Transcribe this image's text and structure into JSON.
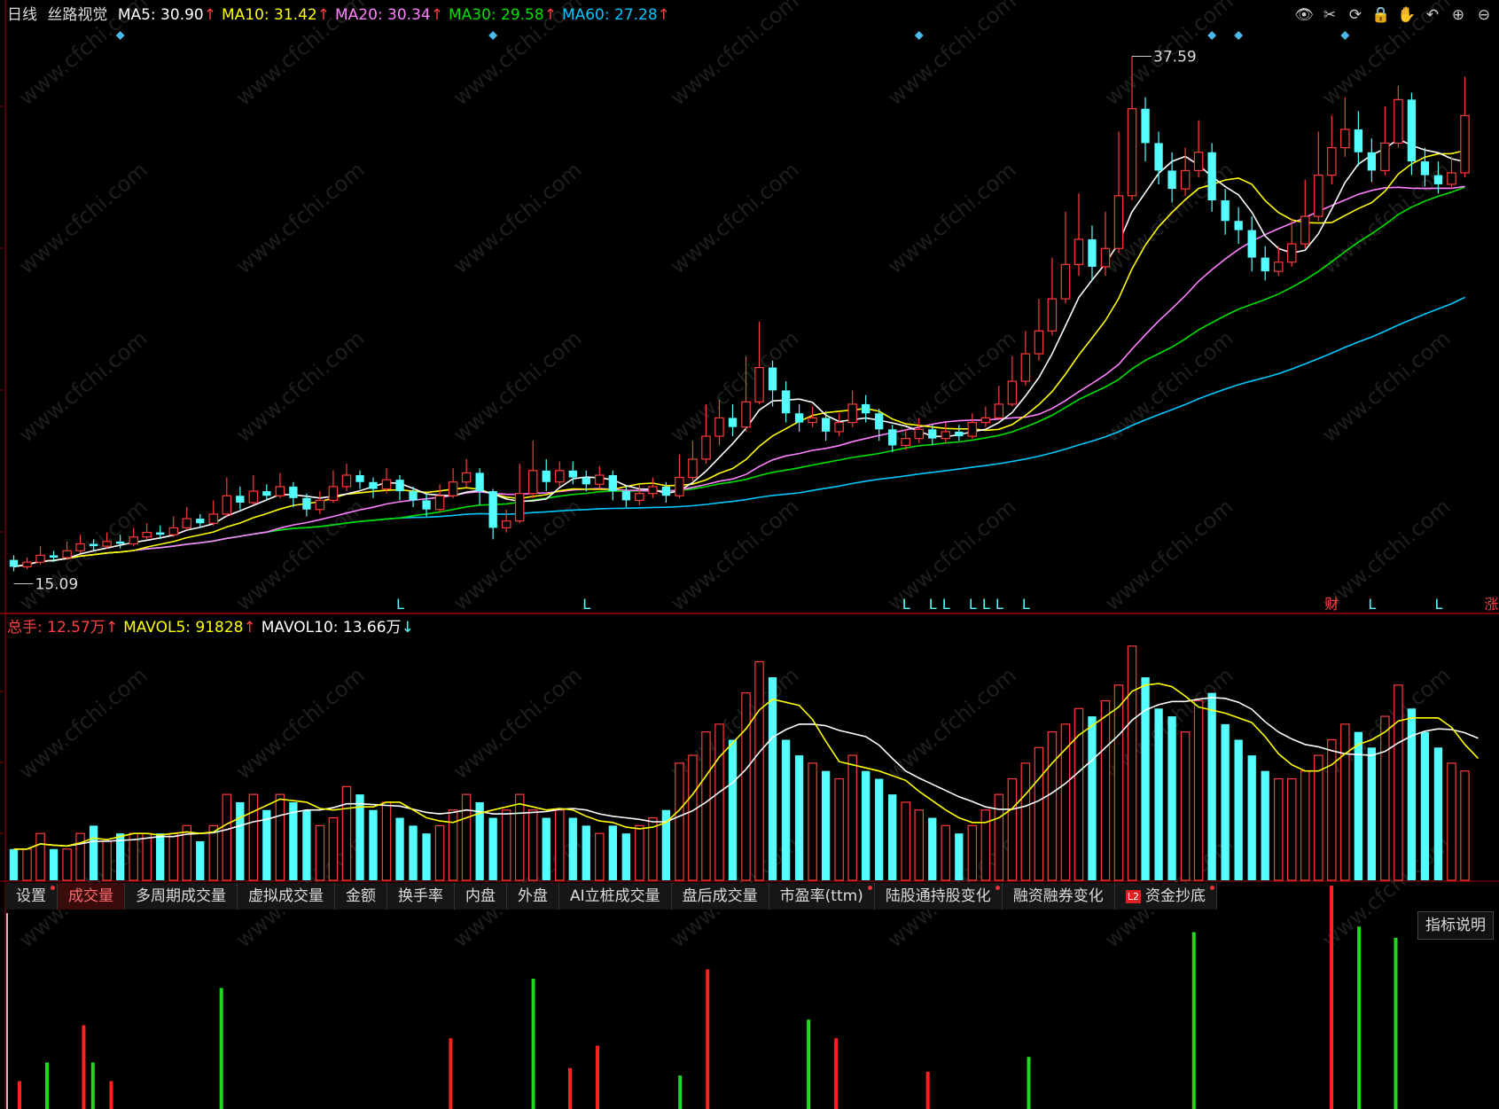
{
  "header": {
    "period": "日线",
    "stock_name": "丝路视觉",
    "ma_items": [
      {
        "label": "MA5: 30.90",
        "arrow": "↑",
        "color": "#ffffff"
      },
      {
        "label": "MA10: 31.42",
        "arrow": "↑",
        "color": "#ffff00"
      },
      {
        "label": "MA20: 30.34",
        "arrow": "↑",
        "color": "#ff80ff"
      },
      {
        "label": "MA30: 29.58",
        "arrow": "↑",
        "color": "#00e000"
      },
      {
        "label": "MA60: 27.28",
        "arrow": "↑",
        "color": "#00c8ff"
      }
    ]
  },
  "toolbar_icons": [
    "eye-icon",
    "scissors-icon",
    "refresh-icon",
    "lock-icon",
    "hand-icon",
    "undo-icon",
    "zoom-in-icon",
    "zoom-out-icon"
  ],
  "annotations": {
    "high_label": "37.59",
    "low_label": "15.09"
  },
  "markers": {
    "L": "L",
    "cai": "财",
    "zhang": "涨"
  },
  "volume_header": {
    "items": [
      {
        "label": "总手: 12.57万",
        "arrow": "↑",
        "color": "#ff4040"
      },
      {
        "label": "MAVOL5: 91828",
        "arrow": "↑",
        "color": "#ffff00"
      },
      {
        "label": "MAVOL10: 13.66万",
        "arrow": "↓",
        "color": "#ffffff"
      }
    ]
  },
  "tabs": [
    {
      "label": "设置",
      "active": false,
      "dot": true
    },
    {
      "label": "成交量",
      "active": true,
      "dot": false
    },
    {
      "label": "多周期成交量",
      "active": false,
      "dot": false
    },
    {
      "label": "虚拟成交量",
      "active": false,
      "dot": false
    },
    {
      "label": "金额",
      "active": false,
      "dot": false
    },
    {
      "label": "换手率",
      "active": false,
      "dot": false
    },
    {
      "label": "内盘",
      "active": false,
      "dot": false
    },
    {
      "label": "外盘",
      "active": false,
      "dot": false
    },
    {
      "label": "AI立桩成交量",
      "active": false,
      "dot": false
    },
    {
      "label": "盘后成交量",
      "active": false,
      "dot": false
    },
    {
      "label": "市盈率(ttm)",
      "active": false,
      "dot": true
    },
    {
      "label": "陆股通持股变化",
      "active": false,
      "dot": true
    },
    {
      "label": "融资融券变化",
      "active": false,
      "dot": false
    },
    {
      "label": "资金抄底",
      "active": false,
      "dot": true,
      "badge": "L2"
    }
  ],
  "explain_button": "指标说明",
  "watermark": "www.cfchi.com",
  "colors": {
    "up": "#ff3b3b",
    "down": "#54ffff",
    "bg": "#000000",
    "grid": "#7a0000"
  },
  "chart_data": {
    "type": "candlestick",
    "price_range": [
      15.09,
      37.59
    ],
    "high_label": 37.59,
    "low_label": 15.09,
    "candles": [
      [
        15.6,
        15.3,
        15.8,
        15.1
      ],
      [
        15.3,
        15.5,
        15.7,
        15.2
      ],
      [
        15.5,
        15.8,
        16.2,
        15.4
      ],
      [
        15.8,
        15.7,
        16.0,
        15.5
      ],
      [
        15.7,
        16.0,
        16.4,
        15.6
      ],
      [
        16.0,
        16.3,
        16.7,
        15.9
      ],
      [
        16.3,
        16.2,
        16.5,
        16.0
      ],
      [
        16.2,
        16.4,
        16.8,
        16.1
      ],
      [
        16.4,
        16.3,
        16.7,
        16.1
      ],
      [
        16.3,
        16.6,
        17.0,
        16.2
      ],
      [
        16.6,
        16.8,
        17.2,
        16.5
      ],
      [
        16.8,
        16.7,
        17.1,
        16.5
      ],
      [
        16.7,
        17.0,
        17.5,
        16.6
      ],
      [
        17.0,
        17.4,
        17.9,
        16.9
      ],
      [
        17.4,
        17.2,
        17.6,
        17.0
      ],
      [
        17.2,
        17.6,
        18.2,
        17.1
      ],
      [
        17.6,
        18.4,
        19.2,
        17.5
      ],
      [
        18.4,
        18.1,
        18.8,
        17.8
      ],
      [
        18.1,
        18.6,
        19.3,
        18.0
      ],
      [
        18.6,
        18.4,
        18.9,
        18.2
      ],
      [
        18.4,
        18.8,
        19.4,
        18.3
      ],
      [
        18.8,
        18.3,
        19.0,
        17.9
      ],
      [
        18.3,
        17.8,
        18.5,
        17.5
      ],
      [
        17.8,
        18.2,
        18.6,
        17.6
      ],
      [
        18.2,
        18.8,
        19.5,
        18.1
      ],
      [
        18.8,
        19.3,
        19.8,
        18.6
      ],
      [
        19.3,
        19.0,
        19.5,
        18.7
      ],
      [
        19.0,
        18.7,
        19.2,
        18.3
      ],
      [
        18.7,
        19.1,
        19.6,
        18.5
      ],
      [
        19.1,
        18.6,
        19.3,
        18.2
      ],
      [
        18.6,
        18.2,
        18.8,
        17.9
      ],
      [
        18.2,
        17.8,
        18.5,
        17.5
      ],
      [
        17.8,
        18.4,
        18.9,
        17.7
      ],
      [
        18.4,
        19.0,
        19.6,
        18.3
      ],
      [
        19.0,
        19.4,
        20.0,
        18.8
      ],
      [
        19.4,
        18.6,
        19.6,
        18.0
      ],
      [
        18.6,
        17.0,
        18.7,
        16.5
      ],
      [
        17.0,
        17.3,
        17.8,
        16.8
      ],
      [
        17.3,
        18.5,
        19.8,
        17.2
      ],
      [
        18.5,
        19.5,
        20.8,
        18.3
      ],
      [
        19.5,
        19.0,
        20.0,
        18.6
      ],
      [
        19.0,
        19.5,
        19.9,
        18.8
      ],
      [
        19.5,
        19.2,
        19.9,
        18.9
      ],
      [
        19.2,
        18.9,
        19.5,
        18.6
      ],
      [
        18.9,
        19.3,
        19.7,
        18.7
      ],
      [
        19.3,
        18.6,
        19.5,
        18.2
      ],
      [
        18.6,
        18.2,
        18.8,
        17.9
      ],
      [
        18.2,
        18.5,
        18.9,
        18.0
      ],
      [
        18.5,
        18.8,
        19.2,
        18.3
      ],
      [
        18.8,
        18.4,
        19.0,
        18.1
      ],
      [
        18.4,
        19.2,
        20.2,
        18.3
      ],
      [
        19.2,
        20.0,
        20.8,
        19.0
      ],
      [
        20.0,
        21.0,
        22.4,
        19.8
      ],
      [
        21.0,
        21.8,
        22.6,
        20.6
      ],
      [
        21.8,
        21.4,
        22.4,
        21.0
      ],
      [
        21.4,
        22.5,
        24.5,
        21.2
      ],
      [
        22.5,
        24.0,
        26.0,
        22.4
      ],
      [
        24.0,
        23.0,
        24.3,
        22.3
      ],
      [
        23.0,
        22.0,
        23.4,
        21.6
      ],
      [
        22.0,
        21.6,
        22.4,
        21.2
      ],
      [
        21.6,
        21.8,
        22.3,
        21.4
      ],
      [
        21.8,
        21.2,
        22.1,
        20.8
      ],
      [
        21.2,
        21.6,
        22.0,
        21.0
      ],
      [
        21.6,
        22.4,
        23.0,
        21.4
      ],
      [
        22.4,
        22.0,
        22.8,
        21.6
      ],
      [
        22.0,
        21.3,
        22.2,
        20.8
      ],
      [
        21.3,
        20.6,
        21.5,
        20.3
      ],
      [
        20.6,
        20.9,
        21.3,
        20.4
      ],
      [
        20.9,
        21.3,
        21.8,
        20.7
      ],
      [
        21.3,
        20.9,
        21.5,
        20.6
      ],
      [
        20.9,
        21.2,
        21.6,
        20.7
      ],
      [
        21.2,
        21.0,
        21.5,
        20.8
      ],
      [
        21.0,
        21.6,
        22.0,
        20.9
      ],
      [
        21.6,
        21.8,
        22.3,
        21.4
      ],
      [
        21.8,
        22.4,
        23.2,
        21.7
      ],
      [
        22.4,
        23.4,
        24.5,
        22.3
      ],
      [
        23.4,
        24.6,
        25.6,
        23.2
      ],
      [
        24.6,
        25.6,
        27.0,
        24.3
      ],
      [
        25.6,
        27.0,
        28.8,
        25.4
      ],
      [
        27.0,
        28.5,
        30.8,
        26.8
      ],
      [
        28.5,
        29.6,
        31.6,
        28.0
      ],
      [
        29.6,
        28.4,
        30.2,
        27.8
      ],
      [
        28.4,
        29.2,
        30.8,
        28.0
      ],
      [
        29.2,
        31.5,
        34.3,
        29.0
      ],
      [
        31.5,
        35.3,
        37.59,
        31.3
      ],
      [
        35.3,
        33.8,
        35.8,
        33.0
      ],
      [
        33.8,
        32.6,
        34.3,
        32.0
      ],
      [
        32.6,
        31.8,
        33.4,
        31.2
      ],
      [
        31.8,
        32.6,
        33.6,
        31.5
      ],
      [
        32.6,
        33.4,
        34.8,
        32.3
      ],
      [
        33.4,
        31.3,
        33.8,
        30.8
      ],
      [
        31.3,
        30.4,
        31.8,
        29.8
      ],
      [
        30.4,
        30.0,
        31.0,
        29.4
      ],
      [
        30.0,
        28.8,
        30.6,
        28.2
      ],
      [
        28.8,
        28.2,
        29.3,
        27.8
      ],
      [
        28.2,
        28.6,
        29.3,
        28.0
      ],
      [
        28.6,
        29.4,
        30.5,
        28.4
      ],
      [
        29.4,
        30.6,
        32.2,
        29.2
      ],
      [
        30.6,
        32.4,
        34.3,
        30.4
      ],
      [
        32.4,
        33.6,
        35.0,
        32.0
      ],
      [
        33.6,
        34.4,
        35.8,
        33.2
      ],
      [
        34.4,
        33.4,
        35.2,
        32.8
      ],
      [
        33.4,
        32.6,
        34.0,
        32.1
      ],
      [
        32.6,
        33.8,
        35.4,
        32.4
      ],
      [
        33.8,
        35.7,
        36.3,
        33.6
      ],
      [
        35.7,
        33.0,
        36.0,
        32.4
      ],
      [
        33.0,
        32.4,
        33.6,
        31.9
      ],
      [
        32.4,
        32.0,
        33.0,
        31.6
      ],
      [
        32.0,
        32.5,
        33.2,
        31.8
      ],
      [
        32.5,
        35.0,
        36.7,
        32.3
      ]
    ],
    "moving_averages": {
      "MA5": {
        "current": 30.9,
        "color": "#ffffff"
      },
      "MA10": {
        "current": 31.42,
        "color": "#ffff00"
      },
      "MA20": {
        "current": 30.34,
        "color": "#ff80ff"
      },
      "MA30": {
        "current": 29.58,
        "color": "#00e000"
      },
      "MA60": {
        "current": 27.28,
        "color": "#00c8ff"
      }
    },
    "l_markers": [
      29,
      43,
      67,
      69,
      70,
      72,
      73,
      74,
      76,
      102,
      107
    ],
    "cai_marker": 99,
    "zhang_marker": 111,
    "volume": {
      "total": "12.57万",
      "mavol5": 91828,
      "mavol10": "13.66万",
      "values": [
        2.0,
        2.0,
        3.0,
        2.0,
        2.0,
        3.0,
        3.5,
        2.5,
        3.0,
        3.0,
        3.0,
        3.0,
        3.0,
        3.5,
        2.5,
        3.5,
        5.5,
        5.0,
        5.5,
        4.5,
        5.5,
        5.0,
        4.5,
        3.5,
        4.0,
        6.0,
        5.5,
        4.5,
        5.0,
        4.0,
        3.5,
        3.0,
        3.5,
        4.5,
        5.5,
        5.0,
        4.0,
        4.5,
        5.5,
        4.5,
        4.0,
        4.5,
        4.0,
        3.5,
        3.0,
        3.5,
        3.0,
        3.5,
        4.0,
        4.5,
        7.5,
        8.0,
        9.5,
        10.0,
        9.0,
        12.0,
        14.0,
        13.0,
        9.0,
        8.0,
        7.5,
        7.0,
        6.5,
        8.0,
        7.0,
        6.5,
        5.5,
        5.0,
        4.5,
        4.0,
        3.5,
        3.0,
        3.5,
        4.5,
        5.5,
        6.5,
        7.5,
        8.5,
        9.5,
        10.0,
        11.0,
        10.5,
        11.5,
        12.5,
        15.0,
        13.0,
        11.0,
        10.5,
        9.5,
        11.5,
        12.0,
        10.0,
        9.0,
        8.0,
        7.0,
        6.5,
        6.5,
        7.0,
        8.0,
        9.0,
        10.0,
        9.5,
        8.5,
        10.5,
        12.5,
        11.0,
        9.5,
        8.5,
        7.5,
        7.0,
        6.5
      ],
      "unit": "万"
    },
    "capital_bottom": {
      "bars": [
        {
          "i": 0,
          "v": 0.15,
          "c": "red"
        },
        {
          "i": 3,
          "v": 0.25,
          "c": "green"
        },
        {
          "i": 7,
          "v": 0.45,
          "c": "red"
        },
        {
          "i": 8,
          "v": 0.25,
          "c": "green"
        },
        {
          "i": 10,
          "v": 0.15,
          "c": "red"
        },
        {
          "i": 22,
          "v": 0.65,
          "c": "green"
        },
        {
          "i": 47,
          "v": 0.38,
          "c": "red"
        },
        {
          "i": 56,
          "v": 0.7,
          "c": "green"
        },
        {
          "i": 60,
          "v": 0.22,
          "c": "red"
        },
        {
          "i": 63,
          "v": 0.34,
          "c": "red"
        },
        {
          "i": 72,
          "v": 0.18,
          "c": "green"
        },
        {
          "i": 75,
          "v": 0.75,
          "c": "red"
        },
        {
          "i": 86,
          "v": 0.48,
          "c": "green"
        },
        {
          "i": 89,
          "v": 0.38,
          "c": "red"
        },
        {
          "i": 99,
          "v": 0.2,
          "c": "red"
        },
        {
          "i": 110,
          "v": 0.28,
          "c": "green"
        },
        {
          "i": 128,
          "v": 0.95,
          "c": "green"
        },
        {
          "i": 143,
          "v": 1.2,
          "c": "red"
        },
        {
          "i": 146,
          "v": 0.98,
          "c": "green"
        },
        {
          "i": 150,
          "v": 0.92,
          "c": "green"
        }
      ]
    }
  }
}
